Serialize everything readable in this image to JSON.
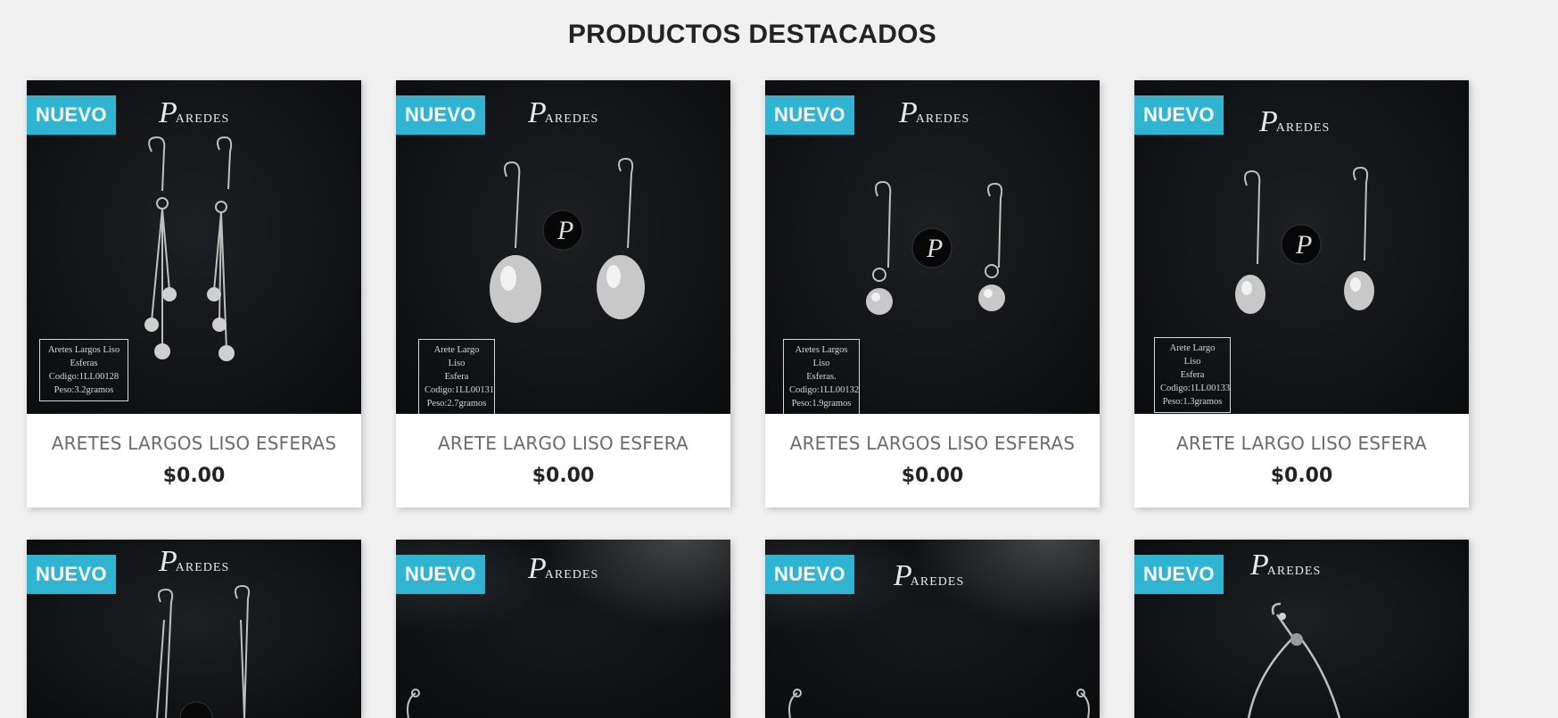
{
  "section": {
    "title": "PRODUCTOS DESTACADOS"
  },
  "products": [
    {
      "badge": "NUEVO",
      "brand_initial": "P",
      "brand_rest": "AREDES",
      "name": "ARETES LARGOS LISO ESFERAS",
      "price": "$0.00",
      "tag_lines": [
        "Aretes Largos Liso Esferas",
        "Codigo:1LL00128",
        "Peso:3.2gramos"
      ],
      "image": "long-dangle-earrings-spheres"
    },
    {
      "badge": "NUEVO",
      "brand_initial": "P",
      "brand_rest": "AREDES",
      "name": "ARETE LARGO LISO ESFERA",
      "price": "$0.00",
      "tag_lines": [
        "Arete Largo Liso",
        "Esfera",
        "Codigo:1LL00131",
        "Peso:2.7gramos"
      ],
      "image": "large-oval-drop-earrings"
    },
    {
      "badge": "NUEVO",
      "brand_initial": "P",
      "brand_rest": "AREDES",
      "name": "ARETES LARGOS LISO ESFERAS",
      "price": "$0.00",
      "tag_lines": [
        "Aretes Largos Liso",
        "Esferas.",
        "Codigo:1LL00132",
        "Peso:1.9gramos"
      ],
      "image": "small-ball-drop-earrings"
    },
    {
      "badge": "NUEVO",
      "brand_initial": "P",
      "brand_rest": "AREDES",
      "name": "ARETE LARGO LISO ESFERA",
      "price": "$0.00",
      "tag_lines": [
        "Arete Largo Liso",
        "Esfera",
        "Codigo:1LL00133",
        "Peso:1.3gramos"
      ],
      "image": "oval-drop-earrings"
    },
    {
      "badge": "NUEVO",
      "brand_initial": "P",
      "brand_rest": "AREDES",
      "image": "thin-bar-earrings"
    },
    {
      "badge": "NUEVO",
      "brand_initial": "P",
      "brand_rest": "AREDES",
      "image": "chain-jewelry"
    },
    {
      "badge": "NUEVO",
      "brand_initial": "P",
      "brand_rest": "AREDES",
      "image": "chain-jewelry"
    },
    {
      "badge": "NUEVO",
      "brand_initial": "P",
      "brand_rest": "AREDES",
      "image": "slider-bracelet"
    }
  ]
}
